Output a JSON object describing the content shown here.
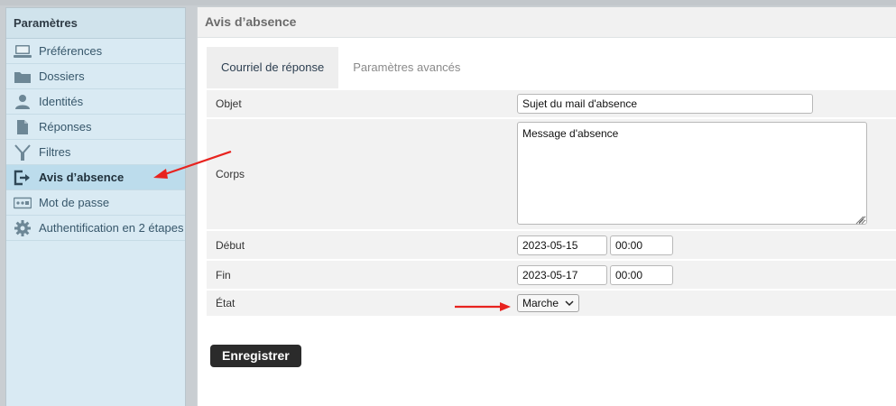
{
  "sidebar": {
    "title": "Paramètres",
    "items": [
      {
        "label": "Préférences",
        "icon": "laptop-icon"
      },
      {
        "label": "Dossiers",
        "icon": "folder-icon"
      },
      {
        "label": "Identités",
        "icon": "user-icon"
      },
      {
        "label": "Réponses",
        "icon": "document-icon"
      },
      {
        "label": "Filtres",
        "icon": "filter-icon"
      },
      {
        "label": "Avis d’absence",
        "icon": "logout-icon",
        "selected": true
      },
      {
        "label": "Mot de passe",
        "icon": "password-icon"
      },
      {
        "label": "Authentification en 2 étapes",
        "icon": "gear-icon"
      }
    ]
  },
  "main": {
    "title": "Avis d’absence",
    "tabs": [
      {
        "label": "Courriel de réponse",
        "active": true
      },
      {
        "label": "Paramètres avancés",
        "active": false
      }
    ],
    "form": {
      "subject_label": "Objet",
      "subject_value": "Sujet du mail d'absence",
      "body_label": "Corps",
      "body_value": "Message d'absence",
      "start_label": "Début",
      "start_date": "2023-05-15",
      "start_time": "00:00",
      "end_label": "Fin",
      "end_date": "2023-05-17",
      "end_time": "00:00",
      "state_label": "État",
      "state_value": "Marche"
    },
    "save_label": "Enregistrer"
  },
  "colors": {
    "sidebar_bg": "#d9eaf3",
    "selected_bg": "#bcdcec",
    "annotation_arrow": "#e8231f",
    "save_button": "#2b2b2b"
  }
}
